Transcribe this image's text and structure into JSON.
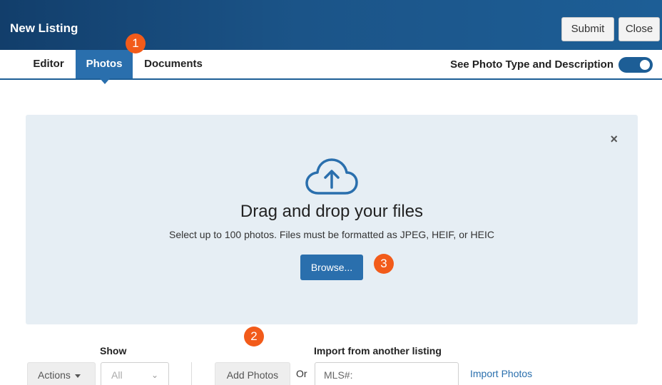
{
  "header": {
    "title": "New Listing",
    "submit_label": "Submit",
    "close_label": "Close"
  },
  "tabs": [
    {
      "label": "Editor",
      "active": false
    },
    {
      "label": "Photos",
      "active": true
    },
    {
      "label": "Documents",
      "active": false
    }
  ],
  "toggle": {
    "label": "See Photo Type and Description",
    "on": true
  },
  "badges": [
    "1",
    "2",
    "3"
  ],
  "dropzone": {
    "close_glyph": "×",
    "icon": "cloud-upload-icon",
    "title": "Drag and drop your files",
    "subtitle": "Select up to 100 photos. Files must be formatted as JPEG, HEIF, or HEIC",
    "browse_label": "Browse..."
  },
  "toolbar": {
    "actions_label": "Actions",
    "show_label": "Show",
    "show_value": "All",
    "add_photos_label": "Add Photos",
    "or_text": "Or",
    "import_label": "Import from another listing",
    "mls_placeholder": "MLS#:",
    "import_photos_label": "Import Photos"
  },
  "colors": {
    "brand": "#1d5e96",
    "accent_badge": "#f25b1a",
    "dropzone_bg": "#e6eef4"
  }
}
